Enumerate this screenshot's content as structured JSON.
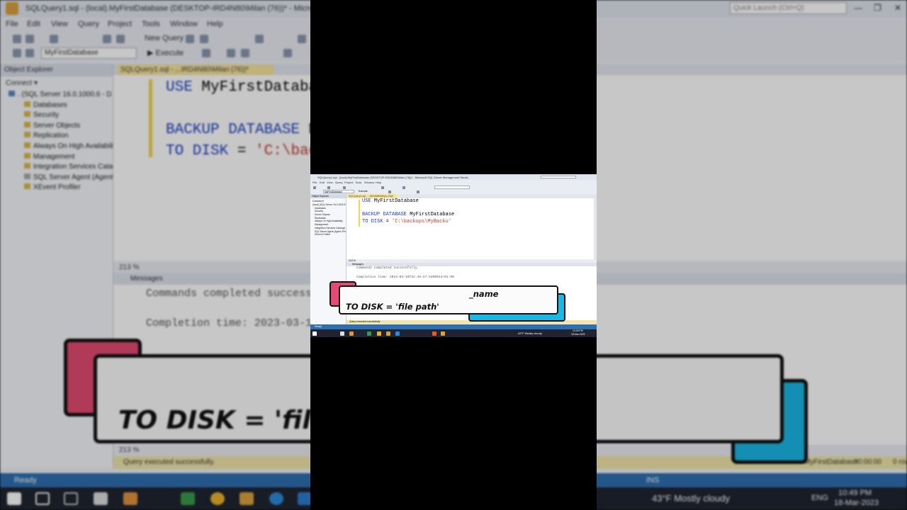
{
  "window": {
    "title": "SQLQuery1.sql - (local).MyFirstDatabase (DESKTOP-IRD4N80\\Milan (76))* - Microsoft SQL Server Management Studio",
    "quick_launch_placeholder": "Quick Launch (Ctrl+Q)",
    "controls": [
      "—",
      "❐",
      "✕"
    ]
  },
  "menu": [
    "File",
    "Edit",
    "View",
    "Query",
    "Project",
    "Tools",
    "Window",
    "Help"
  ],
  "toolbar": {
    "new_query_label": "New Query",
    "database_selector": "MyFirstDatabase",
    "execute_label": "Execute"
  },
  "object_explorer": {
    "title": "Object Explorer",
    "connect_label": "Connect ▾",
    "server_node": "(local) (SQL Server 16.0.1000.6 - DESKTOP-IRD4N80\\Milan)",
    "server_node_bg": ". (SQL Server 16.0.1000.6 - D",
    "nodes": [
      "Databases",
      "Security",
      "Server Objects",
      "Replication",
      "Always On High Availability",
      "Management",
      "Integration Services Catalogs",
      "SQL Server Agent (Agent XPs disabled)",
      "XEvent Profiler"
    ]
  },
  "editor": {
    "tab_label": "SQLQuery1.sql - ...IRD4N80\\Milan (76))*",
    "lines": {
      "l1_kw": "USE",
      "l1_rest": " MyFirstDatabase",
      "l3_kw": "BACKUP DATABASE",
      "l3_rest": " MyFirstDatabase",
      "l4_kw": "TO DISK",
      "l4_eq": " = ",
      "l4_str": "'C:\\backups\\MyBacku'"
    },
    "zoom": "213 %"
  },
  "messages": {
    "tab_label": "Messages",
    "line1": "Commands completed successfully.",
    "line2": "Completion time: 2023-03-18T22:49:27.5490643+01:00"
  },
  "query_status": {
    "text": "Query executed successfully.",
    "database": "MyFirstDatabase",
    "time": "00:00:00",
    "rows": "0 rows"
  },
  "status_bar": {
    "left": "Ready",
    "ins": "INS"
  },
  "taskbar": {
    "weather": "43°F  Mostly cloudy",
    "lang": "ENG",
    "time": "10:49 PM",
    "date": "18-Mar-2023"
  },
  "overlay": {
    "name_fragment": "_name",
    "syntax": "TO DISK = 'file path'",
    "syntax_cropped": "TO DISK = 'file"
  },
  "colors": {
    "accent_pink": "#e34b72",
    "accent_cyan": "#1ab8e6",
    "keyword_blue": "#1a3fc4",
    "string_red": "#c0392b",
    "status_blue": "#2f6fb0"
  }
}
